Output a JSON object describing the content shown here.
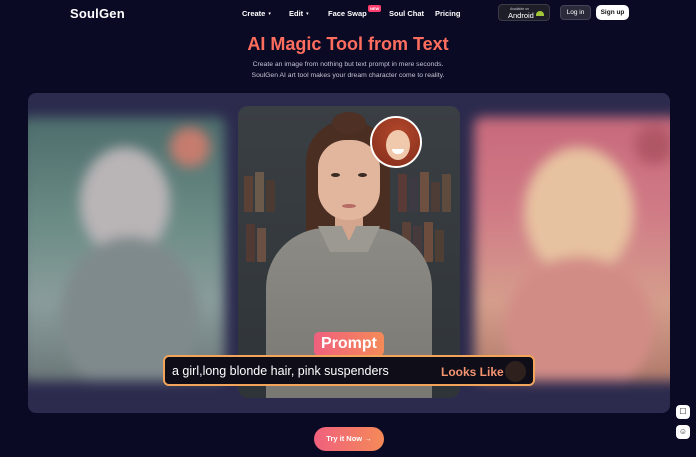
{
  "header": {
    "logo": "SoulGen",
    "nav": [
      {
        "label": "Create",
        "caret": "▾"
      },
      {
        "label": "Edit",
        "caret": "▾"
      },
      {
        "label": "Face Swap",
        "badge": "NEW"
      },
      {
        "label": "Soul Chat"
      },
      {
        "label": "Pricing"
      }
    ],
    "android": {
      "small_text": "Available on",
      "label": "Android"
    },
    "login": "Log in",
    "signup": "Sign up"
  },
  "hero": {
    "title": "AI Magic Tool from Text",
    "subtitle_line1": "Create an image from nothing but text prompt in mere seconds.",
    "subtitle_line2": "SoulGen AI art tool makes your dream character come to reality."
  },
  "showcase": {
    "prompt_tag": "Prompt",
    "prompt_text": "a girl,long blonde hair, pink suspenders",
    "looks_like": "Looks Like"
  },
  "cta": {
    "label": "Try it Now",
    "arrow": "→"
  },
  "float": {
    "top_icon": "☐",
    "bottom_icon": "☺"
  },
  "colors": {
    "background": "#0b0a24",
    "panel": "#2c2b4e",
    "accent_start": "#f0607e",
    "accent_end": "#f48a58",
    "title": "#ff6d5e"
  }
}
